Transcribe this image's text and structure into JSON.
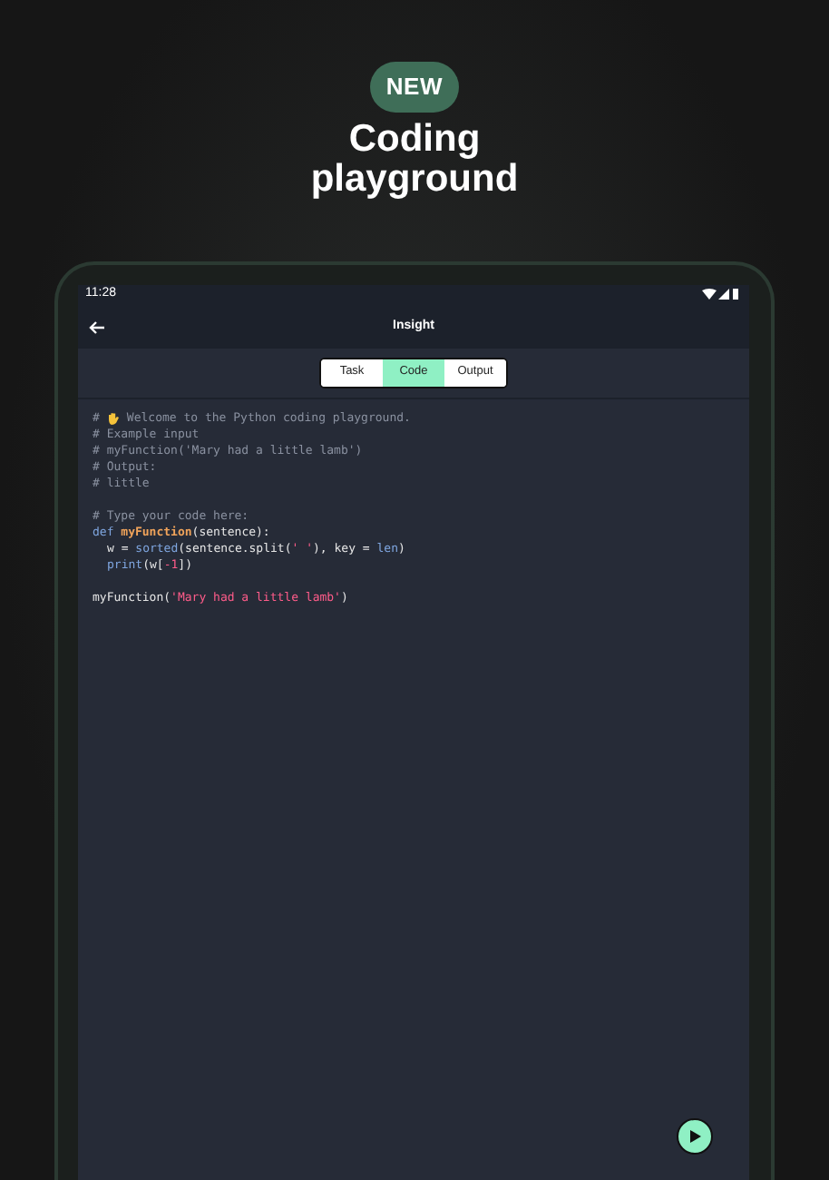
{
  "badge": "NEW",
  "headline": "Coding playground",
  "status_bar": {
    "time": "11:28"
  },
  "app_bar": {
    "title": "Insight"
  },
  "tabs": [
    {
      "label": "Task",
      "selected": false
    },
    {
      "label": "Code",
      "selected": true
    },
    {
      "label": "Output",
      "selected": false
    }
  ],
  "code_lines": [
    {
      "kind": "greeting",
      "tokens": [
        {
          "kind": "comment",
          "text": "#"
        },
        {
          "kind": "comment",
          "text": "Welcome to the Python coding playground."
        }
      ]
    },
    {
      "kind": "code",
      "tokens": [
        {
          "kind": "comment",
          "text": "# Example input"
        }
      ]
    },
    {
      "kind": "code",
      "tokens": [
        {
          "kind": "comment",
          "text": "# myFunction('Mary had a little lamb')"
        }
      ]
    },
    {
      "kind": "code",
      "tokens": [
        {
          "kind": "comment",
          "text": "# Output:"
        }
      ]
    },
    {
      "kind": "code",
      "tokens": [
        {
          "kind": "comment",
          "text": "# little"
        }
      ]
    },
    {
      "kind": "blank"
    },
    {
      "kind": "code",
      "tokens": [
        {
          "kind": "comment",
          "text": "# Type your code here:"
        }
      ]
    },
    {
      "kind": "code",
      "tokens": [
        {
          "kind": "keyword",
          "text": "def "
        },
        {
          "kind": "function",
          "text": "myFunction"
        },
        {
          "kind": "plain",
          "text": "(sentence):"
        }
      ]
    },
    {
      "kind": "indented",
      "tokens": [
        {
          "kind": "plain",
          "text": "w = "
        },
        {
          "kind": "keyword",
          "text": "sorted"
        },
        {
          "kind": "plain",
          "text": "(sentence.split("
        },
        {
          "kind": "string",
          "text": "' '"
        },
        {
          "kind": "plain",
          "text": "), key = "
        },
        {
          "kind": "keyword",
          "text": "len"
        },
        {
          "kind": "plain",
          "text": ")"
        }
      ]
    },
    {
      "kind": "indented",
      "tokens": [
        {
          "kind": "keyword",
          "text": "print"
        },
        {
          "kind": "plain",
          "text": "(w["
        },
        {
          "kind": "number",
          "text": "-1"
        },
        {
          "kind": "plain",
          "text": "])"
        }
      ]
    },
    {
      "kind": "blank"
    },
    {
      "kind": "code",
      "tokens": [
        {
          "kind": "plain",
          "text": "myFunction("
        },
        {
          "kind": "string",
          "text": "'Mary had a little lamb'"
        },
        {
          "kind": "plain",
          "text": ")"
        }
      ]
    }
  ]
}
